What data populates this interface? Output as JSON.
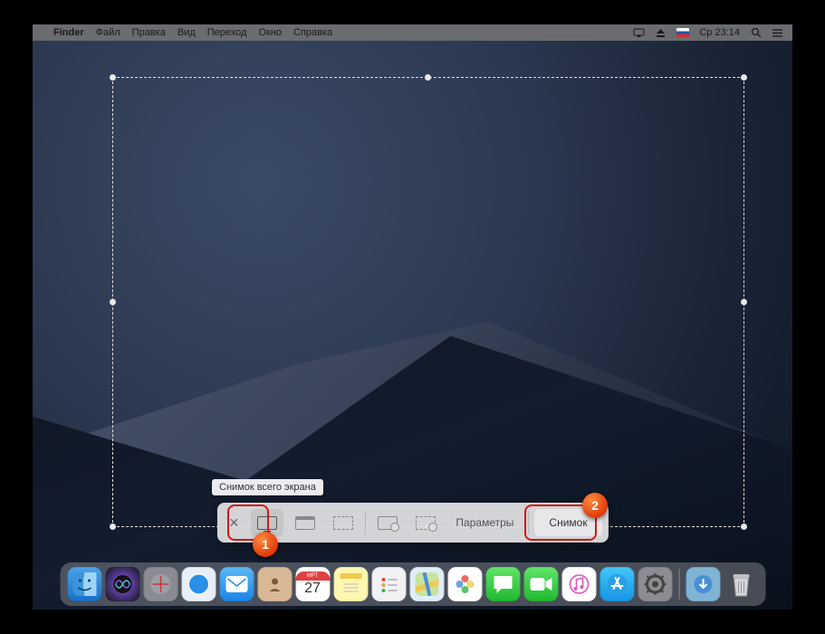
{
  "menubar": {
    "app": "Finder",
    "items": [
      "Файл",
      "Правка",
      "Вид",
      "Переход",
      "Окно",
      "Справка"
    ],
    "clock": "Ср 23:14"
  },
  "tooltip": "Снимок всего экрана",
  "toolbar": {
    "options_label": "Параметры",
    "capture_label": "Снимок"
  },
  "annotations": {
    "badge1": "1",
    "badge2": "2"
  },
  "calendar": {
    "month": "МРТ",
    "day": "27"
  },
  "dock": {
    "items": [
      "finder",
      "siri",
      "launchpad",
      "safari",
      "mail",
      "contacts",
      "calendar",
      "notes",
      "reminders",
      "maps",
      "photos",
      "messages",
      "facetime",
      "itunes",
      "appstore",
      "preferences"
    ],
    "right": [
      "downloads",
      "trash"
    ]
  }
}
